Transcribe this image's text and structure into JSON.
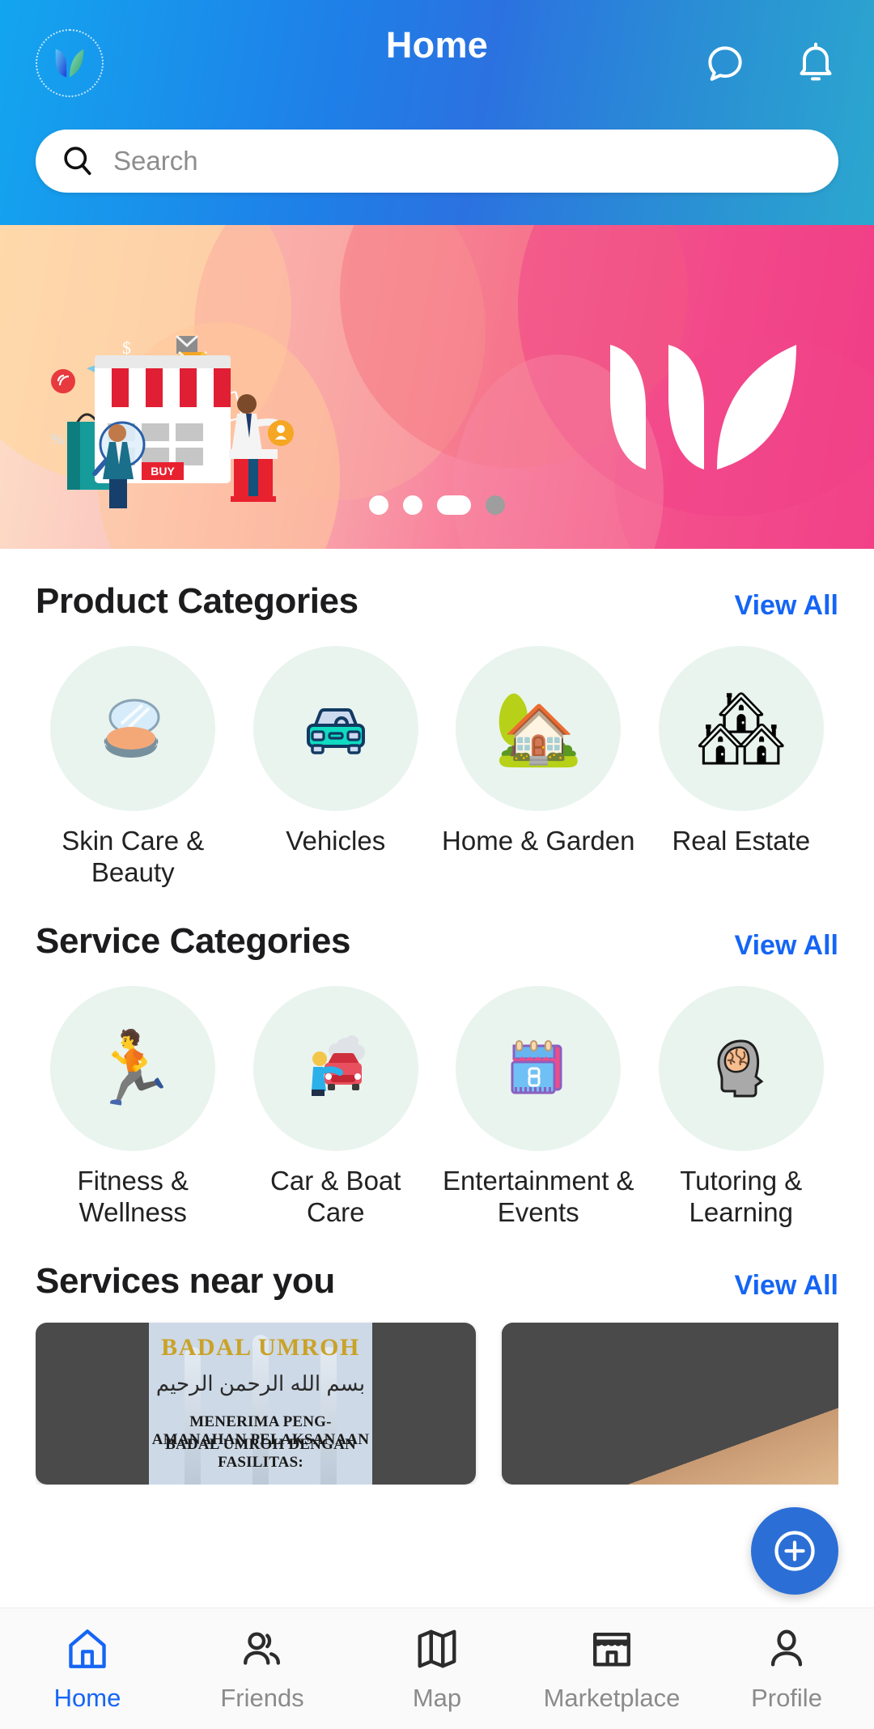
{
  "header": {
    "title": "Home",
    "logo_icon": "leaf-logo-icon",
    "chat_icon": "chat-bubble-icon",
    "notification_icon": "bell-icon",
    "accent_blue": "#1565f5"
  },
  "search": {
    "placeholder": "Search",
    "value": "",
    "icon": "search-icon"
  },
  "banner": {
    "illustration": "online-shopping-storefront-illustration",
    "brand_mark": "leaf-logo-white-icon",
    "dots": [
      {
        "state": "inactive",
        "style": "small-white"
      },
      {
        "state": "inactive",
        "style": "small-white"
      },
      {
        "state": "active",
        "style": "wide-white"
      },
      {
        "state": "inactive",
        "style": "small-gray"
      }
    ]
  },
  "product_categories": {
    "title": "Product Categories",
    "view_all": "View All",
    "items": [
      {
        "label": "Skin Care & Beauty",
        "icon": "makeup-compact-icon",
        "glyph": ""
      },
      {
        "label": "Vehicles",
        "icon": "car-icon",
        "glyph": ""
      },
      {
        "label": "Home & Garden",
        "icon": "house-with-garden-icon",
        "glyph": "🏡"
      },
      {
        "label": "Real Estate",
        "icon": "buildings-icon",
        "glyph": "🏘"
      }
    ]
  },
  "service_categories": {
    "title": "Service Categories",
    "view_all": "View All",
    "items": [
      {
        "label": "Fitness & Wellness",
        "icon": "running-person-icon",
        "glyph": "🏃"
      },
      {
        "label": "Car & Boat Care",
        "icon": "car-wash-icon",
        "glyph": ""
      },
      {
        "label": "Entertainment & Events",
        "icon": "calendar-icon",
        "glyph": ""
      },
      {
        "label": "Tutoring & Learning",
        "icon": "brain-head-icon",
        "glyph": "🧠"
      }
    ]
  },
  "services_near_you": {
    "title": "Services near you",
    "view_all": "View All",
    "cards": [
      {
        "name": "badal-umroh-service-card",
        "title": "BADAL UMROH",
        "arabic": "بسم الله الرحمن الرحيم",
        "line1": "MENERIMA PENG-AMANAHAN PELAKSANAAN",
        "line2": "BADAL UMROH DENGAN FASILITAS:"
      },
      {
        "name": "second-service-card",
        "title": "",
        "arabic": "",
        "line1": "",
        "line2": ""
      }
    ]
  },
  "fab": {
    "label": "add",
    "icon": "plus-circle-icon",
    "color": "#2b6fd6"
  },
  "bottom_nav": {
    "items": [
      {
        "label": "Home",
        "icon": "home-icon",
        "active": true
      },
      {
        "label": "Friends",
        "icon": "friends-icon",
        "active": false
      },
      {
        "label": "Map",
        "icon": "map-icon",
        "active": false
      },
      {
        "label": "Marketplace",
        "icon": "storefront-icon",
        "active": false
      },
      {
        "label": "Profile",
        "icon": "person-icon",
        "active": false
      }
    ]
  }
}
